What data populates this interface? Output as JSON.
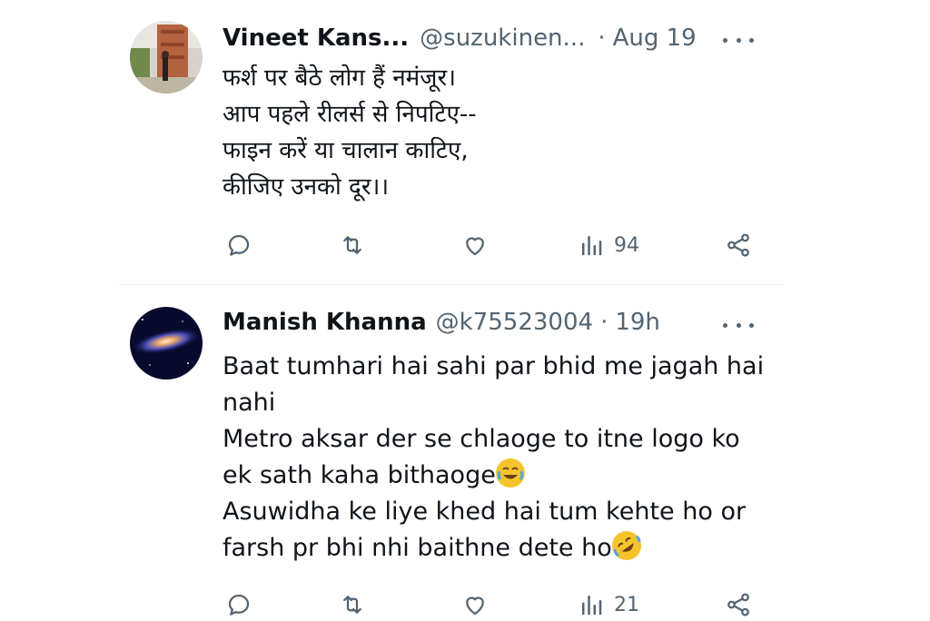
{
  "tweets": [
    {
      "name": "Vineet Kans...",
      "handle": "@suzukinen...",
      "dot": "·",
      "time": "Aug 19",
      "lines": [
        "फर्श पर बैठे लोग हैं नमंजूर।",
        "आप पहले रीलर्स से निपटिए--",
        "फाइन करें या चालान काटिए,",
        "कीजिए उनको दूर।।"
      ],
      "views": "94",
      "avatar_icon": "fort-photo-avatar"
    },
    {
      "name": "Manish Khanna",
      "handle": "@k75523004",
      "dot": "·",
      "time": "19h",
      "lines": [
        "Baat tumhari hai sahi par bhid me jagah hai",
        "nahi",
        "Metro aksar der se chlaoge to itne logo ko",
        "ek sath kaha bithaoge",
        "Asuwidha ke liye khed hai tum kehte ho or",
        "farsh pr bhi nhi baithne dete ho"
      ],
      "emojis": [
        "face-with-tears-of-joy",
        "rolling-on-floor-laughing"
      ],
      "views": "21",
      "avatar_icon": "galaxy-avatar"
    }
  ],
  "icons": {
    "reply": "reply-icon",
    "retweet": "retweet-icon",
    "like": "like-icon",
    "views": "views-icon",
    "share": "share-icon",
    "more": "more-icon"
  },
  "colors": {
    "text": "#0f1419",
    "secondary": "#536471",
    "divider": "#eff3f4"
  }
}
